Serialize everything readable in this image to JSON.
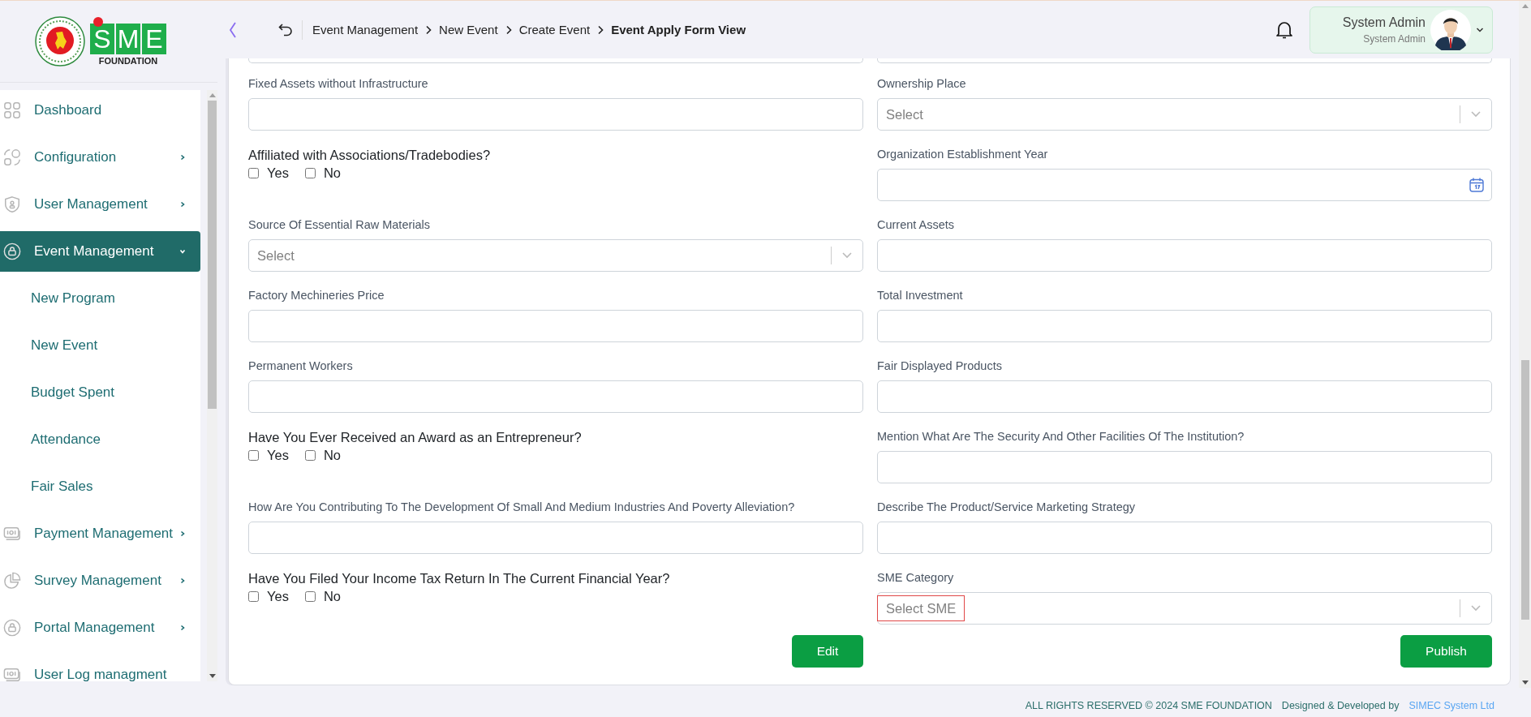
{
  "logo": {
    "letters": [
      "S",
      "M",
      "E"
    ],
    "tagline": "FOUNDATION"
  },
  "sidebar": {
    "items": [
      {
        "label": "Dashboard",
        "selected": false
      },
      {
        "label": "Configuration",
        "selected": false,
        "expanded": false
      },
      {
        "label": "User Management",
        "selected": false,
        "expanded": false
      },
      {
        "label": "Event Management",
        "selected": true,
        "expanded": true,
        "children": [
          {
            "label": "New Program",
            "selected": false
          },
          {
            "label": "New Event",
            "selected": false
          },
          {
            "label": "Budget Spent",
            "selected": false
          },
          {
            "label": "Attendance",
            "selected": false
          },
          {
            "label": "Fair Sales",
            "selected": false
          }
        ]
      },
      {
        "label": "Payment Management",
        "selected": false,
        "expanded": false
      },
      {
        "label": "Survey Management",
        "selected": false,
        "expanded": false
      },
      {
        "label": "Portal Management",
        "selected": false,
        "expanded": false
      },
      {
        "label": "User Log managment",
        "selected": false
      }
    ]
  },
  "header": {
    "breadcrumb": [
      {
        "label": "Event Management",
        "current": false
      },
      {
        "label": "New Event",
        "current": false
      },
      {
        "label": "Create Event",
        "current": false
      },
      {
        "label": "Event Apply Form View",
        "current": true
      }
    ],
    "user": {
      "name": "System Admin",
      "role": "System Admin"
    }
  },
  "form": {
    "fields": [
      {
        "kind": "text",
        "label": "Fixed Assets without Infrastructure"
      },
      {
        "kind": "select",
        "label": "Ownership Place",
        "placeholder": "Select",
        "highlighted": false
      },
      {
        "kind": "question",
        "label": "Affiliated with Associations/Tradebodies?",
        "options": [
          {
            "label": "Yes",
            "checked": false
          },
          {
            "label": "No",
            "checked": false
          }
        ]
      },
      {
        "kind": "date",
        "label": "Organization Establishment Year"
      },
      {
        "kind": "select",
        "label": "Source Of Essential Raw Materials",
        "placeholder": "Select",
        "highlighted": false
      },
      {
        "kind": "text",
        "label": "Current Assets"
      },
      {
        "kind": "text",
        "label": "Factory Mechineries Price"
      },
      {
        "kind": "text",
        "label": "Total Investment"
      },
      {
        "kind": "text",
        "label": "Permanent Workers"
      },
      {
        "kind": "text",
        "label": "Fair Displayed Products"
      },
      {
        "kind": "question",
        "label": "Have You Ever Received an Award as an Entrepreneur?",
        "options": [
          {
            "label": "Yes",
            "checked": false
          },
          {
            "label": "No",
            "checked": false
          }
        ]
      },
      {
        "kind": "text",
        "label": "Mention What Are The Security And Other Facilities Of The Institution?"
      },
      {
        "kind": "text",
        "label": "How Are You Contributing To The Development Of Small And Medium Industries And Poverty Alleviation?"
      },
      {
        "kind": "text",
        "label": "Describe The Product/Service Marketing Strategy"
      },
      {
        "kind": "question",
        "label": "Have You Filed Your Income Tax Return In The Current Financial Year?",
        "options": [
          {
            "label": "Yes",
            "checked": false
          },
          {
            "label": "No",
            "checked": false
          }
        ]
      },
      {
        "kind": "select",
        "label": "SME Category",
        "placeholder": "Select SME",
        "highlighted": true
      }
    ],
    "buttons": [
      "Edit",
      "Publish"
    ]
  },
  "footer": {
    "copyright": "ALL RIGHTS RESERVED © 2024 SME FOUNDATION",
    "credit": "Designed & Developed by",
    "company": "SIMEC System Ltd"
  }
}
